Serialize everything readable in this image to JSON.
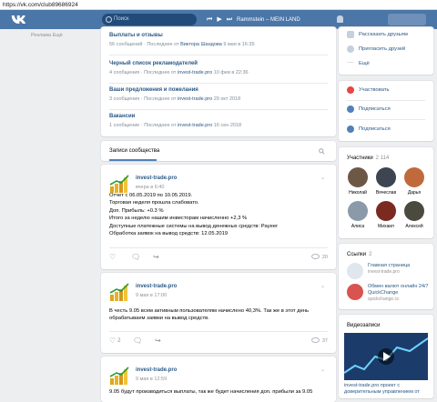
{
  "browser": {
    "url": "https://vk.com/club89686924"
  },
  "topbar": {
    "search_placeholder": "Поиск",
    "track": "Rammstein – MEIN LAND"
  },
  "left_stub": {
    "text": "Реклама  Ещё"
  },
  "forum": {
    "topics": [
      {
        "title": "Выплаты и отзывы",
        "count": "56 сообщений",
        "last_prefix": "Последнее от ",
        "last_author": "Виктора Шандова",
        "last_time": "9 мая в 16:35"
      },
      {
        "title": "Черный список рекламодателей",
        "count": "4 сообщения",
        "last_prefix": "Последнее от ",
        "last_author": "invest-trade.pro",
        "last_time": "10 фев в 22:36"
      },
      {
        "title": "Ваши предложения и пожелания",
        "count": "3 сообщения",
        "last_prefix": "Последнее от ",
        "last_author": "invest-trade.pro",
        "last_time": "29 окт 2018"
      },
      {
        "title": "Вакансии",
        "count": "1 сообщение",
        "last_prefix": "Последнее от ",
        "last_author": "invest-trade.pro",
        "last_time": "16 сен 2018"
      }
    ]
  },
  "wall": {
    "tab": "Записи сообщества"
  },
  "posts": [
    {
      "author": "invest-trade.pro",
      "date": "вчера в 6:40",
      "lines": [
        "Отчет с 06.05.2019 по 10.05.2019.",
        "Торговая неделя прошла слабовато.",
        "Доп. Прибыль: +0.3 %",
        "Итого за неделю нашим инвесторам начисленно +2,3 %",
        "Доступные платежные системы на вывод денежных средств: Payeer",
        "Обработка заявок на вывод средств: 12.05.2019"
      ],
      "likes": "",
      "views": "20"
    },
    {
      "author": "invest-trade.pro",
      "date": "9 мая в 17:00",
      "lines": [
        "В честь 9.05 всем активным пользователям начислено 40,3%. Так же в этот день",
        "обрабатываем заявки на вывод средств."
      ],
      "likes": "2",
      "views": "37"
    },
    {
      "author": "invest-trade.pro",
      "date": "9 мая в 12:59",
      "lines": [
        "9.05 будут производиться выплаты, так же будет начисления доп. прибыли за 9.05"
      ],
      "likes": "",
      "views": ""
    }
  ],
  "sidebar": {
    "top_actions": [
      {
        "label": "Рассказать друзьям"
      },
      {
        "label": "Пригласить друзей"
      },
      {
        "label": "Ещё"
      }
    ],
    "buttons": [
      {
        "label": "Участвовать"
      },
      {
        "label": "Подписаться"
      },
      {
        "label": "Подписаться"
      }
    ],
    "members_title": "Участники",
    "members_count": "2 114",
    "members": [
      {
        "name": "Николай"
      },
      {
        "name": "Вячеслав"
      },
      {
        "name": "Дарья"
      },
      {
        "name": "Алиса"
      },
      {
        "name": "Михаил"
      },
      {
        "name": "Алексей"
      }
    ],
    "links_title": "Ссылки",
    "links_count": "2",
    "links": [
      {
        "title": "Главная страница",
        "sub": "invest-trade.pro"
      },
      {
        "title": "Обмен валют онлайн 24/7 QuickChange",
        "sub": "quickchange.cc"
      }
    ],
    "videos_title": "Видеозаписи",
    "videos_count": "0",
    "video_caption": "invest-trade.pro проект с доверительным управлением от"
  },
  "colors": {
    "brand": "#4a76a8",
    "link": "#2a5885",
    "bg": "#edeef0"
  }
}
